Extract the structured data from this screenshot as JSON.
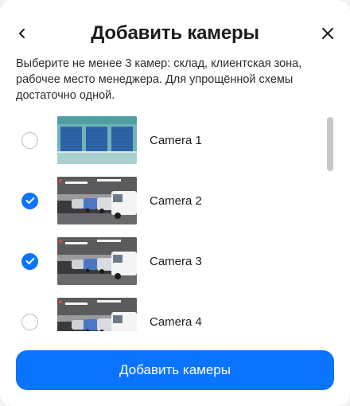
{
  "header": {
    "title": "Добавить камеры",
    "back_icon": "chevron-left-icon",
    "close_icon": "close-icon"
  },
  "description": "Выберите не менее 3 камер: склад, клиентская зона, рабочее место менеджера. Для упрощённой схемы достаточно одной.",
  "cameras": [
    {
      "label": "Camera 1",
      "checked": false,
      "thumbnail": "warehouse-doors-thumbnail"
    },
    {
      "label": "Camera 2",
      "checked": true,
      "thumbnail": "parking-garage-thumbnail"
    },
    {
      "label": "Camera 3",
      "checked": true,
      "thumbnail": "parking-garage-thumbnail"
    },
    {
      "label": "Camera 4",
      "checked": false,
      "thumbnail": "parking-garage-thumbnail"
    }
  ],
  "primary_button": {
    "label": "Добавить камеры"
  },
  "colors": {
    "accent": "#0a74ff",
    "radio_border": "#b9b9be",
    "scrollbar": "#c7c7cc"
  }
}
